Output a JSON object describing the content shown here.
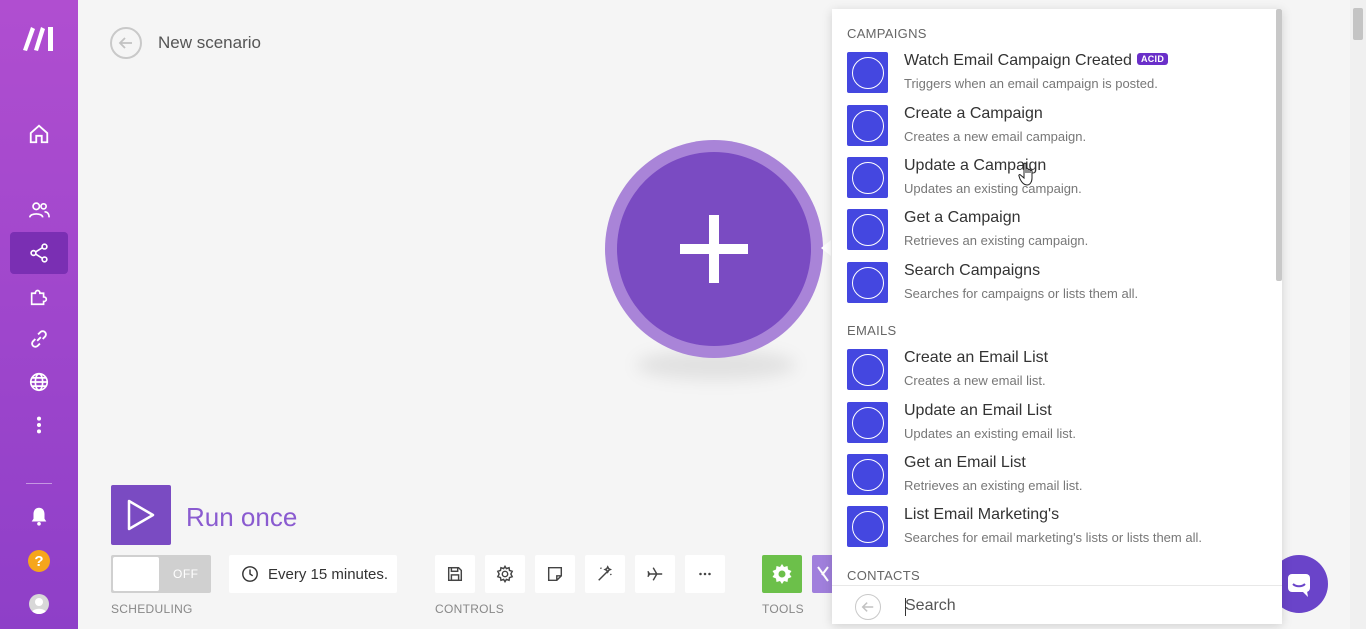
{
  "app": {
    "brand_color": "#7a4bc2"
  },
  "sidebar": {
    "items": [
      {
        "icon": "home-icon"
      },
      {
        "icon": "team-icon"
      },
      {
        "icon": "share-nodes-icon",
        "active": true
      },
      {
        "icon": "puzzle-icon"
      },
      {
        "icon": "link-icon"
      },
      {
        "icon": "globe-icon"
      },
      {
        "icon": "more-vertical-icon"
      }
    ],
    "bell_icon": "bell-icon",
    "help_label": "?",
    "avatar_icon": "user-avatar-icon"
  },
  "header": {
    "title": "New scenario"
  },
  "bottom": {
    "run_label": "Run once",
    "toggle_label": "OFF",
    "schedule_label": "Every 15 minutes.",
    "scheduling_label": "SCHEDULING",
    "controls_label": "CONTROLS",
    "tools_label": "TOOLS"
  },
  "panel": {
    "groups": [
      {
        "title": "CAMPAIGNS",
        "modules": [
          {
            "title": "Watch Email Campaign Created",
            "badge": "ACID",
            "desc": "Triggers when an email campaign is posted."
          },
          {
            "title": "Create a Campaign",
            "desc": "Creates a new email campaign."
          },
          {
            "title": "Update a Campaign",
            "desc": "Updates an existing campaign."
          },
          {
            "title": "Get a Campaign",
            "desc": "Retrieves an existing campaign."
          },
          {
            "title": "Search Campaigns",
            "desc": "Searches for campaigns or lists them all."
          }
        ]
      },
      {
        "title": "EMAILS",
        "modules": [
          {
            "title": "Create an Email List",
            "desc": "Creates a new email list."
          },
          {
            "title": "Update an Email List",
            "desc": "Updates an existing email list."
          },
          {
            "title": "Get an Email List",
            "desc": "Retrieves an existing email list."
          },
          {
            "title": "List Email Marketing's",
            "desc": "Searches for email marketing's lists or lists them all."
          }
        ]
      },
      {
        "title": "CONTACTS",
        "modules": []
      }
    ],
    "search": {
      "placeholder": "Search",
      "value": ""
    }
  }
}
